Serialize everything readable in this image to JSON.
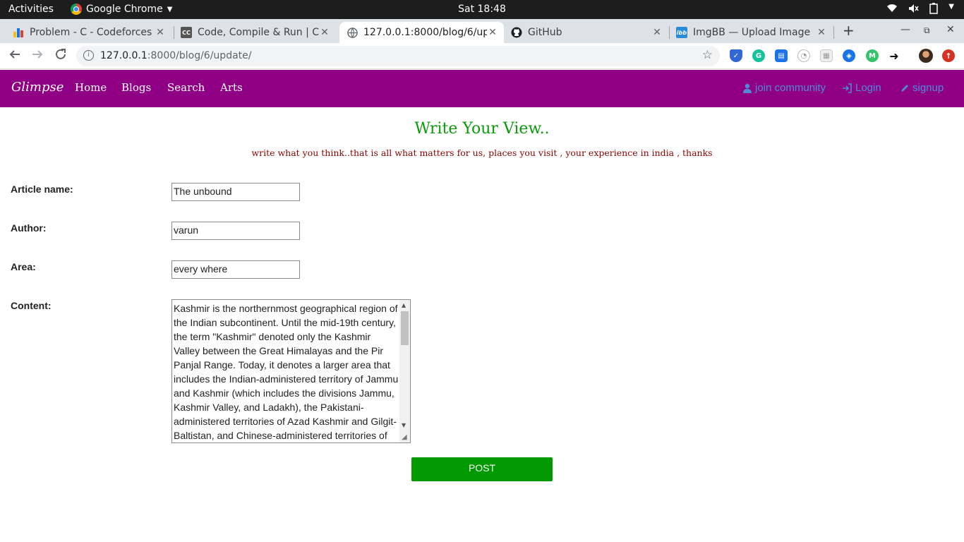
{
  "system": {
    "activities": "Activities",
    "app_name": "Google Chrome",
    "clock": "Sat 18:48"
  },
  "tabs": [
    {
      "title": "Problem - C - Codeforces",
      "active": false
    },
    {
      "title": "Code, Compile & Run | Co",
      "active": false
    },
    {
      "title": "127.0.0.1:8000/blog/6/up",
      "active": true
    },
    {
      "title": "GitHub",
      "active": false
    },
    {
      "title": "ImgBB — Upload Image",
      "active": false
    }
  ],
  "address_bar": {
    "host": "127.0.0.1",
    "path": ":8000/blog/6/update/"
  },
  "site": {
    "brand": "Glimpse",
    "nav": [
      "Home",
      "Blogs",
      "Search",
      "Arts"
    ],
    "join": "join community",
    "login": "Login",
    "signup": "signup"
  },
  "page": {
    "heading": "Write Your View..",
    "subheading": "write what you think..that is all what matters for us, places you visit , your experience in india , thanks"
  },
  "form": {
    "article_label": "Article name:",
    "article_value": "The unbound",
    "author_label": "Author:",
    "author_value": "varun",
    "area_label": "Area:",
    "area_value": "every where",
    "content_label": "Content:",
    "content_value": "Kashmir is the northernmost geographical region of the Indian subcontinent. Until the mid-19th century, the term \"Kashmir\" denoted only the Kashmir Valley between the Great Himalayas and the Pir Panjal Range. Today, it denotes a larger area that includes the Indian-administered territory of Jammu and Kashmir (which includes the divisions Jammu, Kashmir Valley, and Ladakh), the Pakistani-administered territories of Azad Kashmir and Gilgit-Baltistan, and Chinese-administered territories of",
    "post_label": "POST"
  },
  "colors": {
    "navbar": "#8f0085",
    "heading": "#0a9a0a",
    "subheading": "#8b0000",
    "post_button": "#009900",
    "nav_right_links": "#4f8ad9"
  }
}
